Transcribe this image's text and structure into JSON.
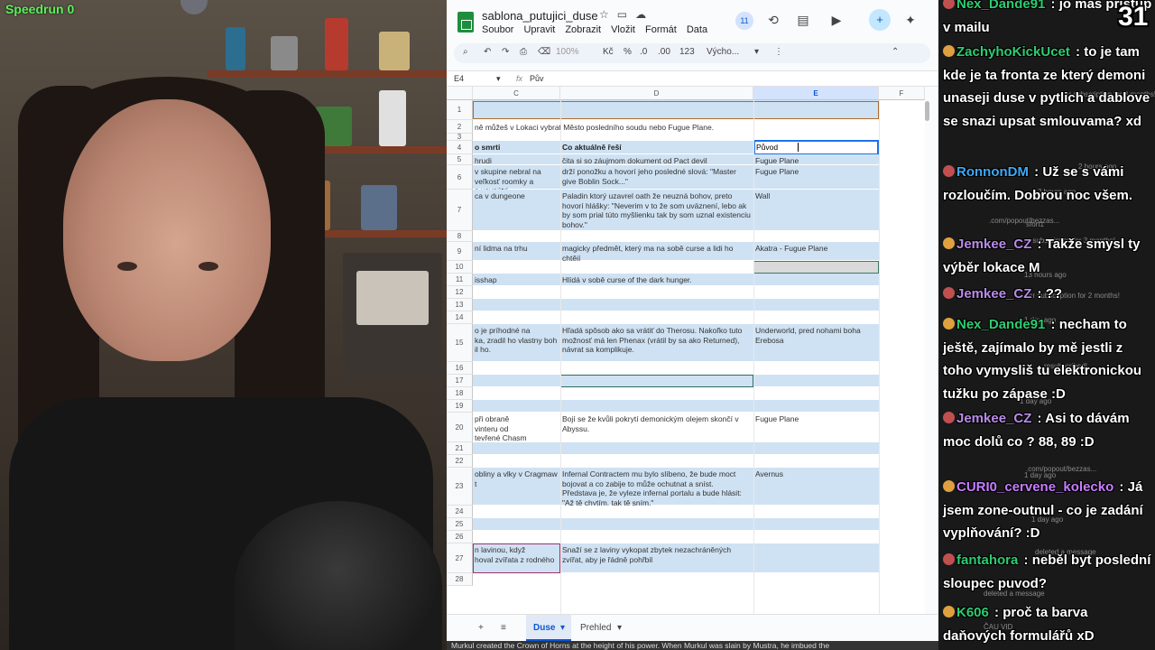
{
  "overlay": {
    "stream_label": "Speedrun 0",
    "viewer_count": "31"
  },
  "sheets": {
    "title": "sablona_putujici_duse",
    "menu": [
      "Soubor",
      "Upravit",
      "Zobrazit",
      "Vložit",
      "Formát",
      "Data"
    ],
    "collab_count": "11",
    "toolbar": {
      "zoom": "100%",
      "currency": "Kč",
      "percent": "%",
      "dec_less": ".0",
      "dec_more": ".00",
      "number_fmt": "123",
      "font": "Výcho..."
    },
    "name_box": "E4",
    "formula": "Pův",
    "columns": [
      "C",
      "D",
      "E",
      "F"
    ],
    "rows": [
      {
        "num": "1",
        "c": "",
        "d": "",
        "e": ""
      },
      {
        "num": "2",
        "c": "ně můžeš v Lokaci vybrat Město posledního soudu nebo Fugue Plane.",
        "d": "",
        "e": ""
      },
      {
        "num": "3",
        "c": "",
        "d": "",
        "e": ""
      },
      {
        "num": "4",
        "c": "o smrti",
        "d": "Co aktuálně řeší",
        "e": "Původ"
      },
      {
        "num": "5",
        "c": "hrudi",
        "d": "čita si so záujmom dokument od Pact devil",
        "e": "Fugue Plane"
      },
      {
        "num": "6",
        "c": "v skupine nebral na\nveľkosť roomky a\na vovnútri",
        "d": "drží ponožku a hovorí jeho posledné slová: \"Master give Boblin Sock...\"",
        "e": "Fugue Plane"
      },
      {
        "num": "7",
        "c": "ca v dungeone",
        "d": "Paladin ktorý uzavrel oath že neuzná bohov, preto hovorí hlášky: \"Neverim v to že som uväznení, lebo ak by som prial túto myšlienku tak by som uznal existenciu bohov.\"",
        "e": "Wall"
      },
      {
        "num": "8",
        "c": "",
        "d": "",
        "e": ""
      },
      {
        "num": "9",
        "c": "ní lidma na trhu",
        "d": "magicky předmět, který ma na sobě curse a lidi ho chtějí",
        "e": "Akatra - Fugue Plane"
      },
      {
        "num": "10",
        "c": "",
        "d": "",
        "e": ""
      },
      {
        "num": "11",
        "c": "isshap",
        "d": "Hlídá v sobě curse of the dark hunger.",
        "e": ""
      },
      {
        "num": "12",
        "c": "",
        "d": "",
        "e": ""
      },
      {
        "num": "13",
        "c": "",
        "d": "",
        "e": ""
      },
      {
        "num": "14",
        "c": "",
        "d": "",
        "e": ""
      },
      {
        "num": "15",
        "c": "o je príhodné na\nka, zradil ho vlastny boh\nil ho.",
        "d": "Hľadá spôsob ako sa vrátiť do Therosu. Nakoľko tuto možnosť má len Phenax (vrátil by sa ako Returned), návrat sa komplikuje.",
        "e": "Underworld, pred nohami boha Erebosa"
      },
      {
        "num": "16",
        "c": "",
        "d": "",
        "e": ""
      },
      {
        "num": "17",
        "c": "",
        "d": "",
        "e": ""
      },
      {
        "num": "18",
        "c": "",
        "d": "",
        "e": ""
      },
      {
        "num": "19",
        "c": "",
        "d": "",
        "e": ""
      },
      {
        "num": "20",
        "c": "při obraně\nvinteru od\ntevřené Chasm",
        "d": "Bojí se že kvůli pokrytí demonickým olejem skončí v Abyssu.",
        "e": "Fugue Plane"
      },
      {
        "num": "21",
        "c": "",
        "d": "",
        "e": ""
      },
      {
        "num": "22",
        "c": "",
        "d": "",
        "e": ""
      },
      {
        "num": "23",
        "c": "obliny a vlky v Cragmaw\nt",
        "d": "Infernal Contractem mu bylo slíbeno, že bude moct bojovat a co zabije to může ochutnat a sníst.\nPředstava je, že vyleze infernal portalu a bude hlásit: \"Až tě chytím, tak tě sním.\"",
        "e": "Avernus"
      },
      {
        "num": "24",
        "c": "",
        "d": "",
        "e": ""
      },
      {
        "num": "25",
        "c": "",
        "d": "",
        "e": ""
      },
      {
        "num": "26",
        "c": "",
        "d": "",
        "e": ""
      },
      {
        "num": "27",
        "c": "n lavinou, když\nhoval zvířata z rodného",
        "d": "Snaží se z laviny vykopat zbytek nezachráněných zvířat, aby je řádně pohřbil",
        "e": ""
      },
      {
        "num": "28",
        "c": "",
        "d": "",
        "e": ""
      }
    ],
    "sheet_tabs": [
      "Duse",
      "Prehled"
    ],
    "bottom_text": "Murkul created the Crown of Horns at the height of his power. When Murkul was slain by Mustra, he imbued the"
  },
  "chat": {
    "messages": [
      {
        "user": "Nex_Dande91",
        "text": "jo mas pristup v mailu",
        "color": "#2ecc71"
      },
      {
        "user": "ZachyhoKickUcet",
        "text": "to je tam kde je ta fronta ze který demoni unaseji duse v pytlich a dablove se snazi upsat smlouvama? xd",
        "color": "#2ecc71"
      },
      {
        "user": "RonnonDM",
        "text": "Už se s vámi rozloučím. Dobrou noc všem.",
        "color": "#3fa9f5"
      },
      {
        "user": "Jemkee_CZ",
        "text": "Takže smysl ty výběr lokace M",
        "color": "#b98ce8"
      },
      {
        "user": "Jemkee_CZ",
        "text": "??",
        "color": "#b98ce8"
      },
      {
        "user": "Nex_Dande91",
        "text": "necham to ještě, zajímalo by mě jestli z toho vymysliš tu elektronickou tužku po zápase :D",
        "color": "#2ecc71"
      },
      {
        "user": "Jemkee_CZ",
        "text": "Asi to dávám moc dolů co ? 88, 89 :D",
        "color": "#b98ce8"
      },
      {
        "user": "CURI0_cervene_kolecko",
        "text": "Já jsem zone-outnul - co je zadání vyplňování? :D",
        "color": "#c77dff"
      },
      {
        "user": "fantahora",
        "text": "neběl byt poslední sloupec puvod?",
        "color": "#2ecc71"
      },
      {
        "user": "K606",
        "text": "proč ta barva daňových formulářů xD",
        "color": "#2ecc71"
      }
    ],
    "bg_texts": [
      "channel",
      "2 hours ago",
      "2 hours ago",
      "er subscription for 3 months!",
      "sfort1",
      "er subscription for 3 months!",
      "13 hours ago",
      "er subscription for 2 months!",
      "1 day ago",
      "resubscribed!",
      "1 day ago",
      ".com/popout/bezzas...",
      "1 day ago",
      "1 day ago",
      "deleted a message",
      "deleted a message",
      "ČAU VID",
      ".com/popout/bezzas..."
    ]
  }
}
